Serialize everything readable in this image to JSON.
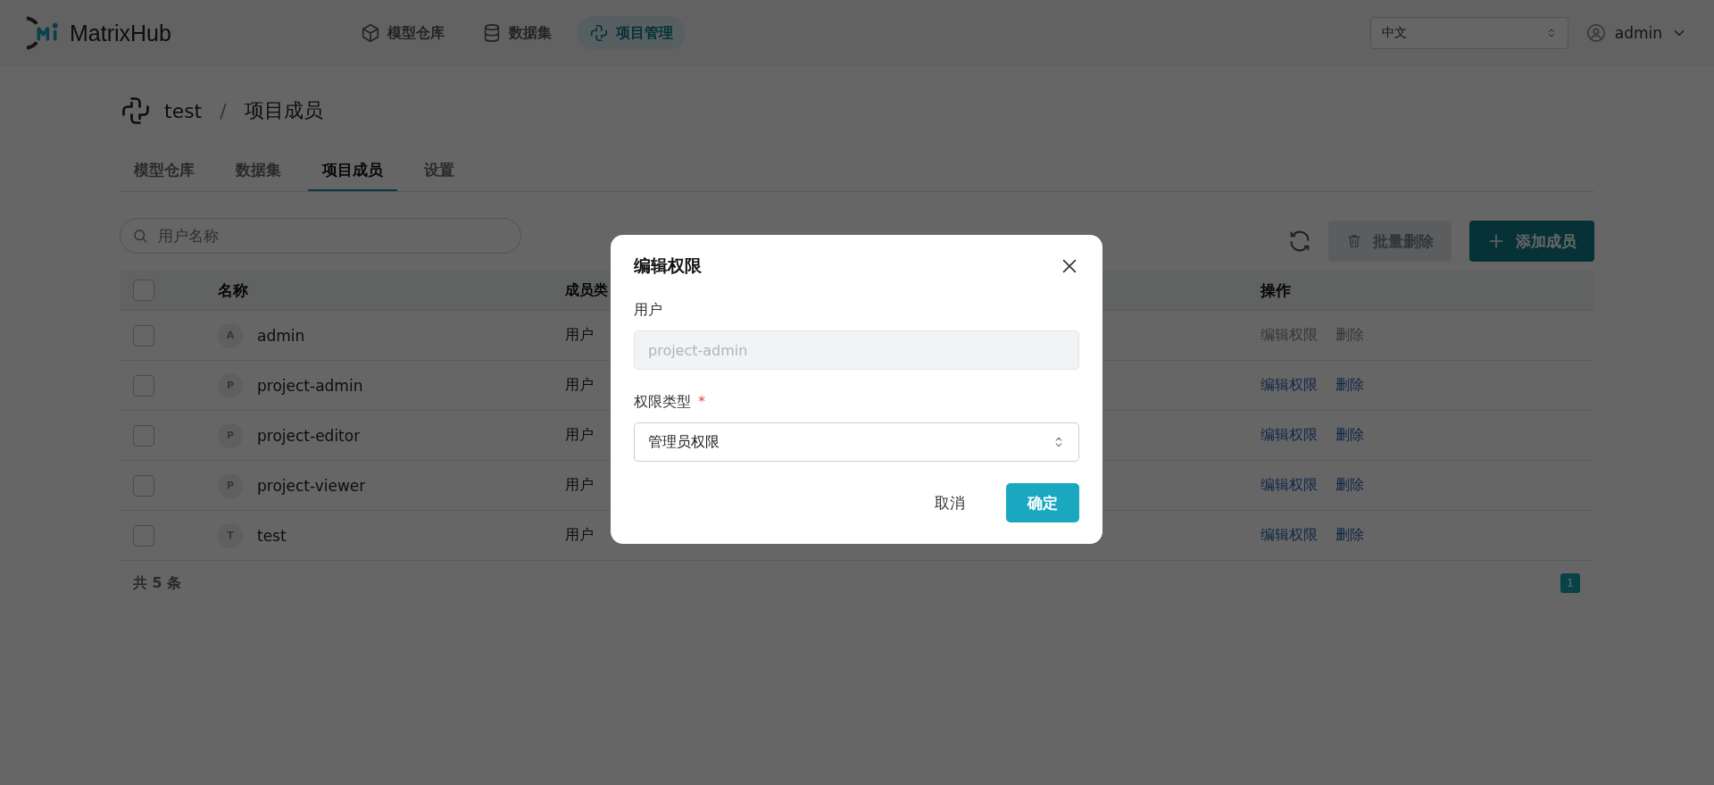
{
  "header": {
    "logo": "MatrixHub",
    "nav": [
      {
        "label": "模型仓库",
        "kind": "cube",
        "selected": false
      },
      {
        "label": "数据集",
        "kind": "database",
        "selected": false
      },
      {
        "label": "项目管理",
        "kind": "project",
        "selected": true
      }
    ],
    "language": "中文",
    "user": "admin"
  },
  "breadcrumb": {
    "project": "test",
    "separator": "/",
    "page": "项目成员"
  },
  "tabs": [
    {
      "label": "模型仓库",
      "selected": false
    },
    {
      "label": "数据集",
      "selected": false
    },
    {
      "label": "项目成员",
      "selected": true
    },
    {
      "label": "设置",
      "selected": false
    }
  ],
  "toolbar": {
    "search_placeholder": "用户名称",
    "bulk_delete": {
      "label": "批量删除",
      "disabled": true
    },
    "add": "添加成员"
  },
  "table": {
    "select_all": {
      "checked": false
    },
    "columns": [
      "名称",
      "成员类",
      "操作"
    ],
    "rows": [
      {
        "checked": false,
        "avatar": "A",
        "name": "admin",
        "type": "用户",
        "actions": [
          {
            "label": "编辑权限",
            "disabled": true
          },
          {
            "label": "删除",
            "disabled": true
          }
        ]
      },
      {
        "checked": false,
        "avatar": "P",
        "name": "project-admin",
        "type": "用户",
        "actions": [
          {
            "label": "编辑权限",
            "disabled": false
          },
          {
            "label": "删除",
            "disabled": false
          }
        ]
      },
      {
        "checked": false,
        "avatar": "P",
        "name": "project-editor",
        "type": "用户",
        "actions": [
          {
            "label": "编辑权限",
            "disabled": false
          },
          {
            "label": "删除",
            "disabled": false
          }
        ]
      },
      {
        "checked": false,
        "avatar": "P",
        "name": "project-viewer",
        "type": "用户",
        "actions": [
          {
            "label": "编辑权限",
            "disabled": false
          },
          {
            "label": "删除",
            "disabled": false
          }
        ]
      },
      {
        "checked": false,
        "avatar": "T",
        "name": "test",
        "type": "用户",
        "actions": [
          {
            "label": "编辑权限",
            "disabled": false
          },
          {
            "label": "删除",
            "disabled": false
          }
        ]
      }
    ]
  },
  "footer": {
    "total": "共 5 条",
    "pages": [
      {
        "label": "1",
        "selected": true
      }
    ]
  },
  "dialog": {
    "title": "编辑权限",
    "fields": [
      {
        "kind": "input",
        "label": "用户",
        "value": "project-admin",
        "disabled": true
      },
      {
        "kind": "select",
        "label": "权限类型",
        "required_mark": "*",
        "value": "管理员权限"
      }
    ],
    "buttons": [
      {
        "label": "取消",
        "kind": "text"
      },
      {
        "label": "确定",
        "kind": "primary"
      }
    ]
  }
}
